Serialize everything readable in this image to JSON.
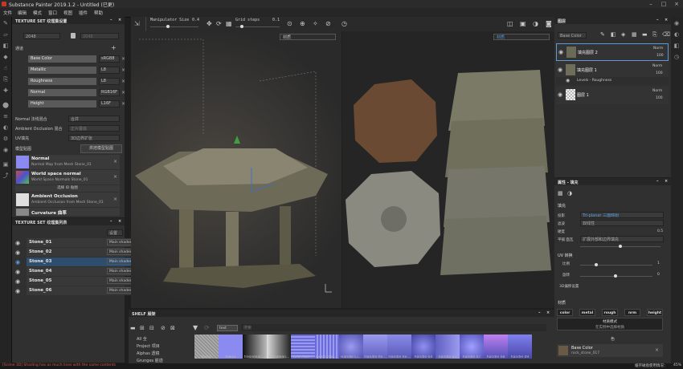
{
  "app_title": "Substance Painter 2019.1.2 - Untitled (已更)",
  "menu": [
    "文件",
    "编辑",
    "模式",
    "窗口",
    "视图",
    "插件",
    "帮助"
  ],
  "toolbar": {
    "manipulator_label": "Manipulator Size",
    "manipulator_value": "0.4",
    "grid_label": "Grid steps",
    "grid_value": "0.1"
  },
  "texture_set_settings": {
    "title": "TEXTURE SET 纹理集设置",
    "size_value": "2048",
    "size_value2": "2048",
    "channels": [
      {
        "name": "Base Color",
        "format": "sRGB8"
      },
      {
        "name": "Metallic",
        "format": "L8"
      },
      {
        "name": "Roughness",
        "format": "L8"
      },
      {
        "name": "Normal",
        "format": "RGB16F"
      },
      {
        "name": "Height",
        "format": "L16F"
      }
    ],
    "normal_mix_label": "Normal 法线混合",
    "normal_mix_value": "合并",
    "ao_mix_label": "Ambient Occlusion 混合",
    "ao_mix_value": "正片叠底",
    "uv_label": "UV填充",
    "uv_value": "3D边界扩张",
    "bake_label": "模型贴图",
    "bake_button": "烘焙模型贴图",
    "maps": [
      {
        "name": "Normal",
        "sub": "Normal Map from Mesh Stone_01"
      },
      {
        "name": "World space normal",
        "sub": "World Space Normals Stone_01"
      },
      {
        "name": "选择 ID 贴图",
        "sub": ""
      },
      {
        "name": "Ambient Occlusion",
        "sub": "Ambient Occlusion from Mesh Stone_01"
      },
      {
        "name": "Curvature 曲率",
        "sub": ""
      }
    ]
  },
  "texture_set_list": {
    "title": "TEXTURE SET 纹理集列表",
    "mode": "设置",
    "items": [
      {
        "name": "Stone_01",
        "shader": "Main shader"
      },
      {
        "name": "Stone_02",
        "shader": "Main shader"
      },
      {
        "name": "Stone_03",
        "shader": "Main shader"
      },
      {
        "name": "Stone_04",
        "shader": "Main shader"
      },
      {
        "name": "Stone_05",
        "shader": "Main shader"
      },
      {
        "name": "Stone_06",
        "shader": "Main shader"
      }
    ]
  },
  "viewport": {
    "left_dropdown": "材质",
    "right_dropdown": "材质"
  },
  "layers": {
    "title": "图层",
    "channel_dropdown": "Base Color",
    "items": [
      {
        "name": "填充图层 2",
        "blend": "Norm",
        "opacity": "100"
      },
      {
        "name": "填充图层 1",
        "blend": "Norm",
        "opacity": "100"
      },
      {
        "name": "Levels - Roughness",
        "blend": "",
        "opacity": ""
      },
      {
        "name": "图层 1",
        "blend": "Norm",
        "opacity": "100"
      }
    ]
  },
  "properties": {
    "title": "属性 - 填充",
    "fill_label": "填充",
    "projection_label": "投影",
    "projection_value": "Tri-planar 三面映射",
    "filter_label": "滤波",
    "filter_value": "双线性",
    "hardness_label": "硬度",
    "hardness_value": "0.5",
    "wrap_label": "平铺 面瓦",
    "wrap_value": "扩展外部和边界填充",
    "uv_section": "UV 转换",
    "scale_label": "比例",
    "scale_value": "1",
    "rotation_label": "旋转",
    "rotation_value": "0",
    "sub_label": "3D偏移设置",
    "material_section": "材质",
    "material_buttons": [
      "color",
      "metal",
      "rough",
      "nrm",
      "height"
    ],
    "material_mode": "材质模式",
    "material_hint": "在实例中选择材质",
    "channel_label": "色",
    "base_color_title": "Base Color",
    "base_color_value": "rock_stone_017"
  },
  "shelf": {
    "title": "SHELF 展架",
    "search_placeholder": "搜索",
    "filter_tag": "text",
    "categories": [
      "All 全",
      "Project 项目",
      "Alphas 透镜",
      "Grunges 脏迹"
    ],
    "items": [
      "fibers",
      "flakes",
      "fresnelian...",
      "fresnelian...",
      "Grid Alter...",
      "Grid Cross...",
      "Handle Ci...",
      "Handle Re...",
      "Handle Re...",
      "handle 04",
      "handle 05",
      "handle 07",
      "handle 08",
      "handle 09"
    ]
  },
  "status": {
    "message": "[Scene 3D] Shading has as much lines with the same contents",
    "right_info": "缓存磁盘使用情况：",
    "percent": "45%"
  }
}
